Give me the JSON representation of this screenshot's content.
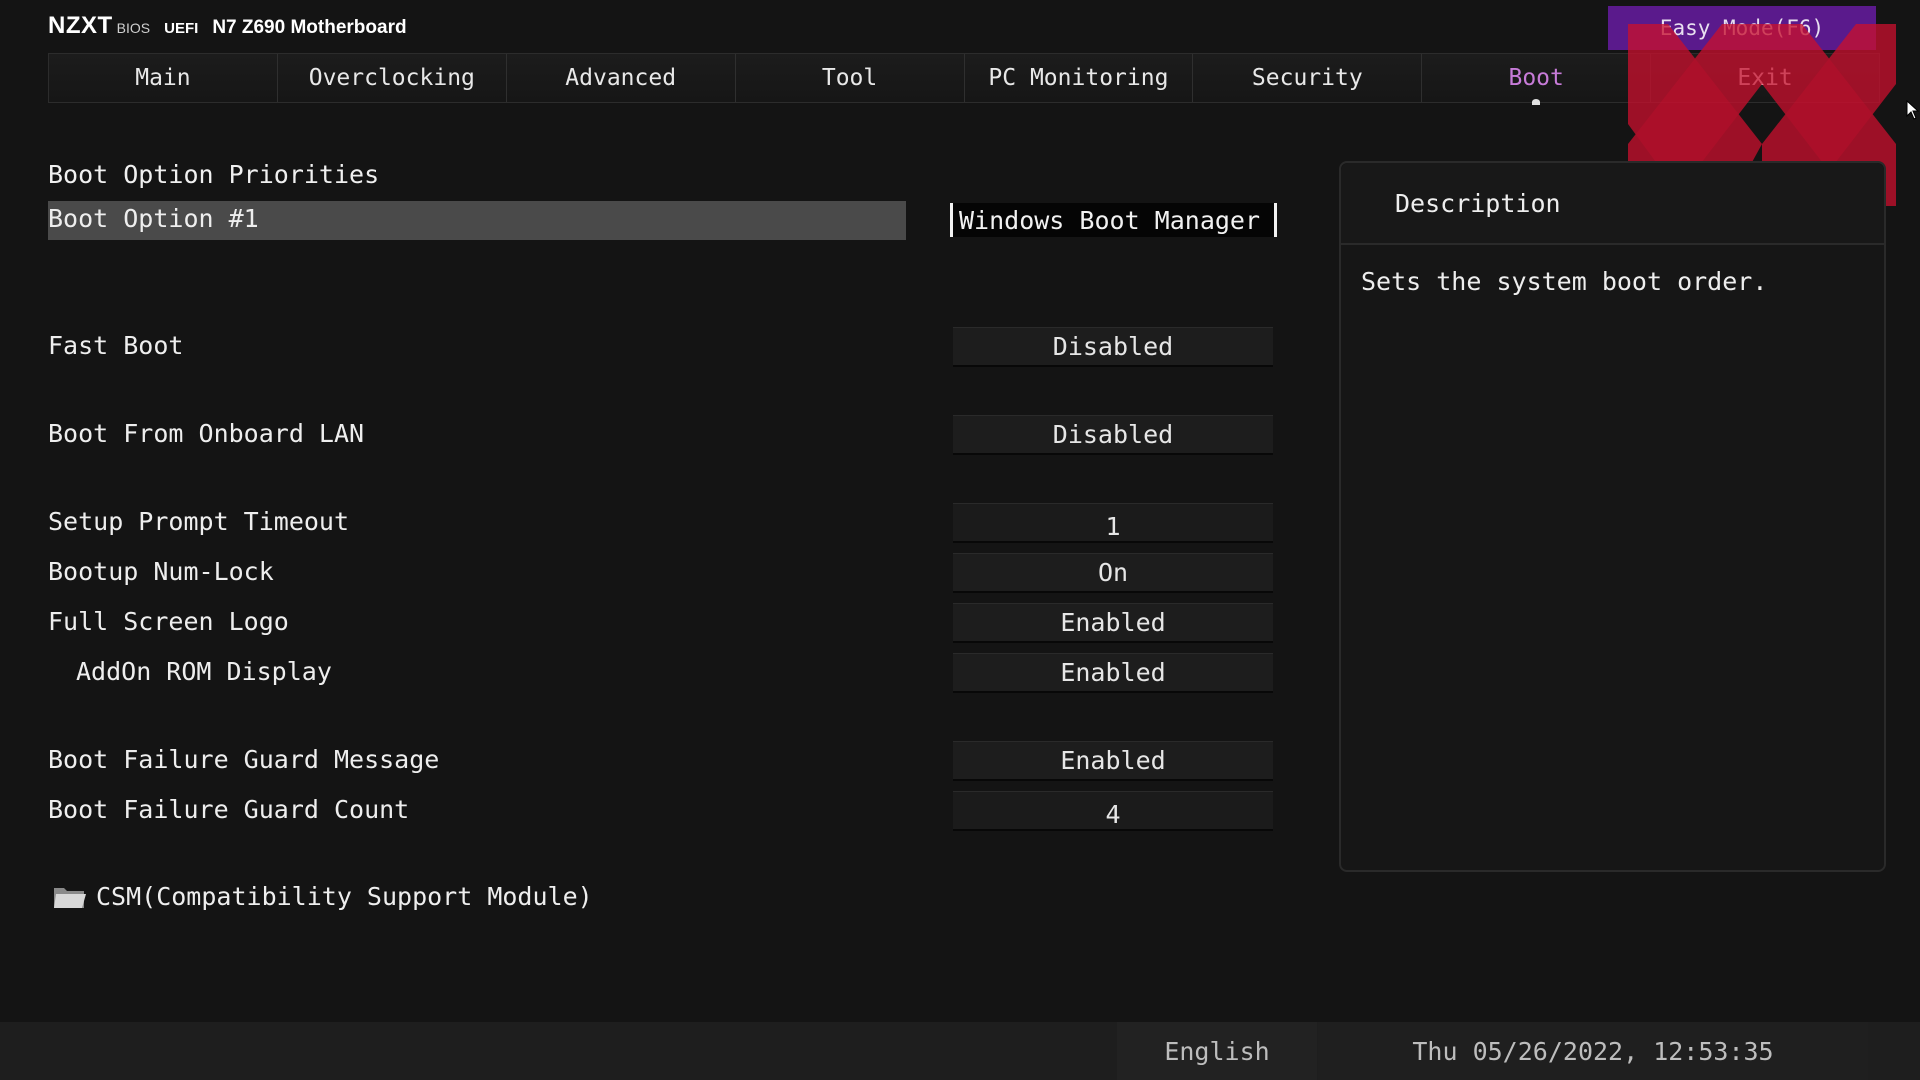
{
  "header": {
    "brand": "NZXT",
    "bios": "BIOS",
    "uefi": "UEFI",
    "model": "N7 Z690 Motherboard",
    "easy_mode": "Easy Mode(F6)"
  },
  "tabs": [
    {
      "label": "Main",
      "active": false
    },
    {
      "label": "Overclocking",
      "active": false
    },
    {
      "label": "Advanced",
      "active": false
    },
    {
      "label": "Tool",
      "active": false
    },
    {
      "label": "PC Monitoring",
      "active": false
    },
    {
      "label": "Security",
      "active": false
    },
    {
      "label": "Boot",
      "active": true
    },
    {
      "label": "Exit",
      "active": false
    }
  ],
  "settings": {
    "section_title": "Boot Option Priorities",
    "boot_option_1": {
      "label": "Boot Option #1",
      "value": "Windows Boot Manager ..."
    },
    "fast_boot": {
      "label": "Fast Boot",
      "value": "Disabled"
    },
    "onboard_lan": {
      "label": "Boot From Onboard LAN",
      "value": "Disabled"
    },
    "setup_prompt": {
      "label": "Setup Prompt Timeout",
      "value": "1"
    },
    "numlock": {
      "label": "Bootup Num-Lock",
      "value": "On"
    },
    "fullscreen_logo": {
      "label": "Full Screen Logo",
      "value": "Enabled"
    },
    "addon_rom": {
      "label": "AddOn ROM Display",
      "value": "Enabled"
    },
    "guard_message": {
      "label": "Boot Failure Guard Message",
      "value": "Enabled"
    },
    "guard_count": {
      "label": "Boot Failure Guard Count",
      "value": "4"
    },
    "csm": {
      "label": "CSM(Compatibility Support Module)",
      "icon": "folder-icon"
    }
  },
  "description": {
    "title": "Description",
    "text": "Sets the system boot order."
  },
  "footer": {
    "language": "English",
    "datetime": "Thu 05/26/2022, 12:53:35"
  },
  "colors": {
    "accent_purple": "#5a1a8c",
    "active_tab": "#c77bd8",
    "watermark_red": "#c8102e",
    "background": "#141414"
  }
}
